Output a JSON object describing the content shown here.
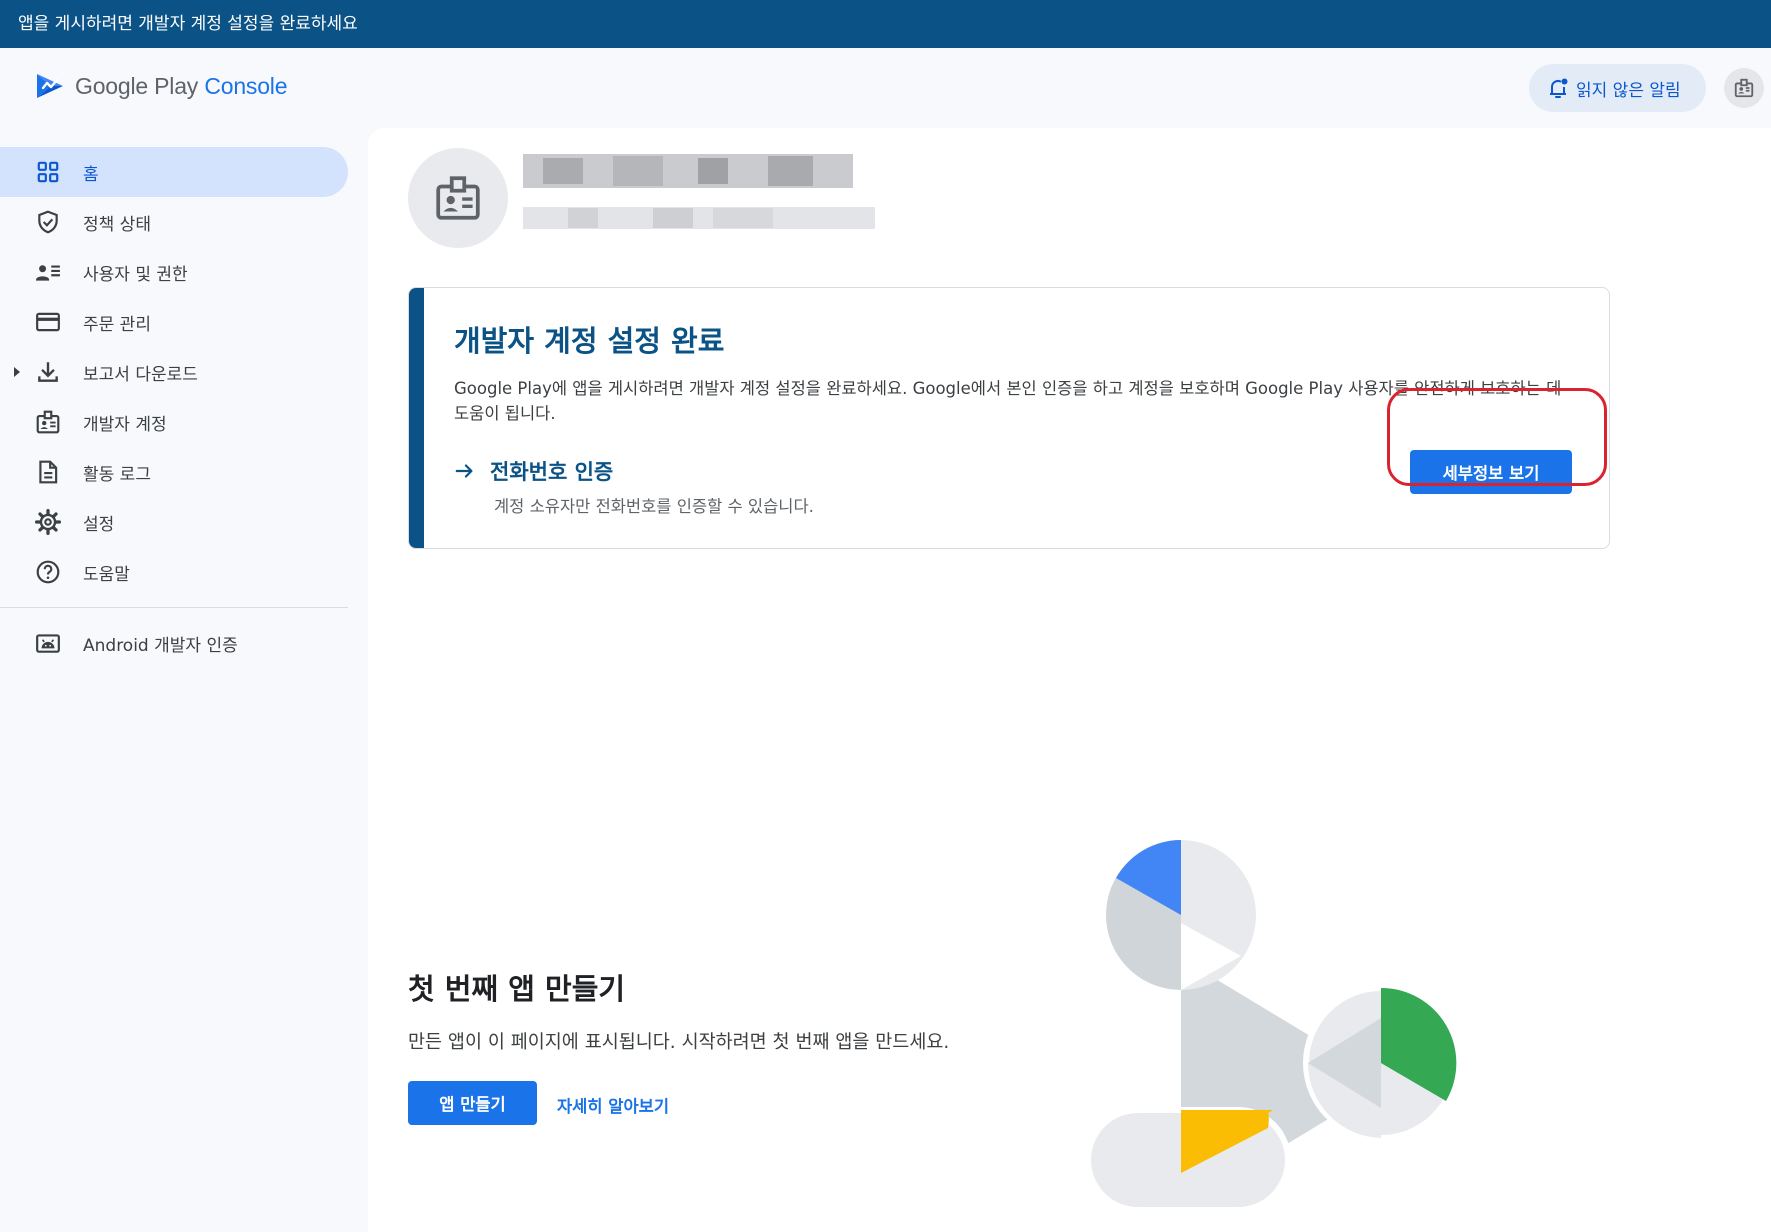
{
  "banner": {
    "text": "앱을 게시하려면 개발자 계정 설정을 완료하세요"
  },
  "header": {
    "logo": {
      "google_play": "Google Play",
      "console": "Console"
    },
    "notifications_label": "읽지 않은 알림",
    "account_icon": "account-badge-icon"
  },
  "sidebar": {
    "items": [
      {
        "label": "홈",
        "icon": "dashboard-grid-icon",
        "active": true
      },
      {
        "label": "정책 상태",
        "icon": "shield-check-icon"
      },
      {
        "label": "사용자 및 권한",
        "icon": "users-list-icon"
      },
      {
        "label": "주문 관리",
        "icon": "credit-card-icon"
      },
      {
        "label": "보고서 다운로드",
        "icon": "download-icon",
        "expandable": true
      },
      {
        "label": "개발자 계정",
        "icon": "badge-icon"
      },
      {
        "label": "활동 로그",
        "icon": "document-icon"
      },
      {
        "label": "설정",
        "icon": "gear-icon"
      },
      {
        "label": "도움말",
        "icon": "help-circle-icon"
      }
    ],
    "footer_items": [
      {
        "label": "Android 개발자 인증",
        "icon": "android-icon"
      }
    ]
  },
  "account_header": {
    "avatar_icon": "badge-icon",
    "name_redacted": true,
    "id_redacted": true
  },
  "setup_card": {
    "title": "개발자 계정 설정 완료",
    "description": "Google Play에 앱을 게시하려면 개발자 계정 설정을 완료하세요. Google에서 본인 인증을 하고 계정을 보호하며 Google Play 사용자를 안전하게 보호하는 데 도움이 됩니다.",
    "task_title": "전화번호 인증",
    "task_subtitle": "계정 소유자만 전화번호를 인증할 수 있습니다.",
    "button_label": "세부정보 보기"
  },
  "first_app": {
    "title": "첫 번째 앱 만들기",
    "description": "만든 앱이 이 페이지에 표시됩니다. 시작하려면 첫 번째 앱을 만드세요.",
    "create_button": "앱 만들기",
    "learn_more": "자세히 알아보기"
  },
  "colors": {
    "banner": "#0b5386",
    "primary": "#1a73e8",
    "active_nav": "#d3e3fd",
    "highlight": "#d9232f",
    "illustration_blue": "#4285f4",
    "illustration_green": "#34a853",
    "illustration_yellow": "#fbbc04"
  }
}
